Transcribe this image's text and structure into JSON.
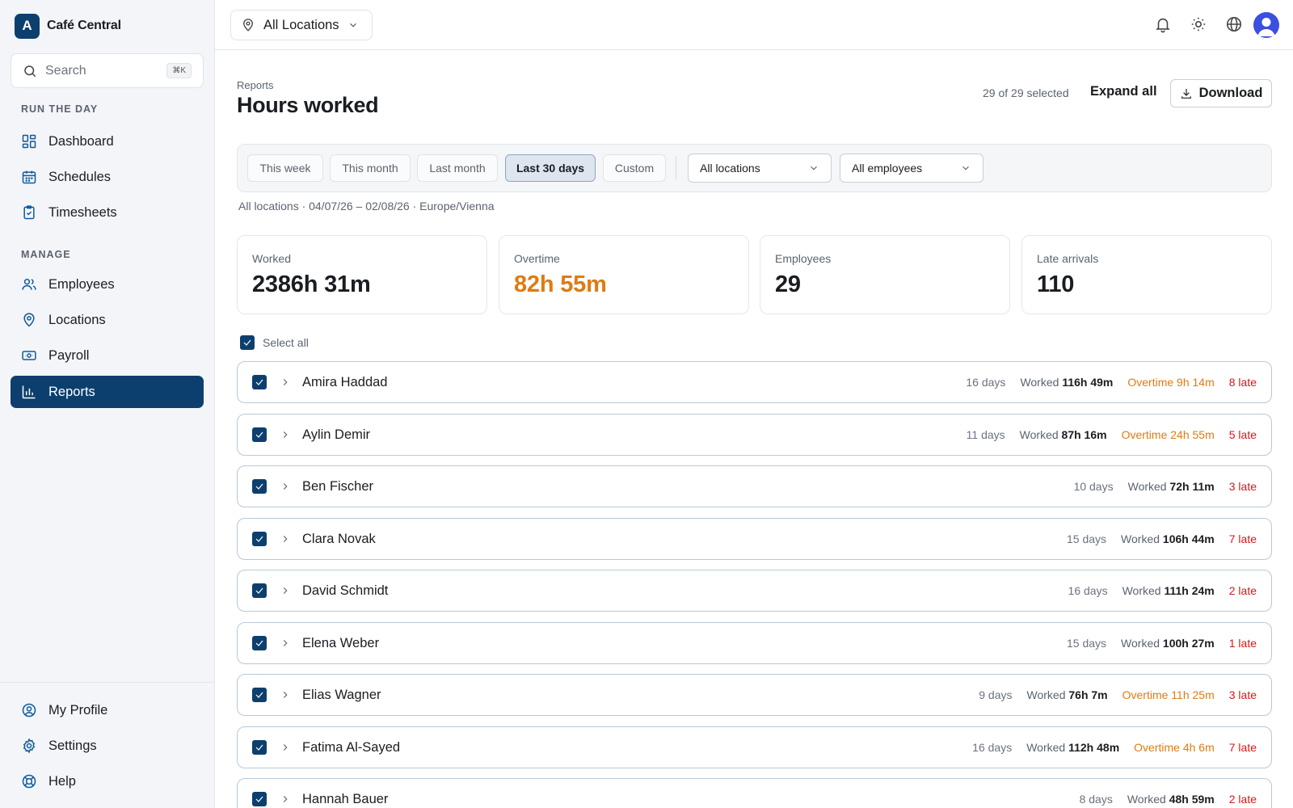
{
  "brand": {
    "logo_letter": "A",
    "name": "Café Central"
  },
  "search": {
    "placeholder": "Search",
    "shortcut": "⌘K"
  },
  "sidebar": {
    "sections": [
      {
        "label": "RUN THE DAY"
      },
      {
        "label": "MANAGE"
      }
    ],
    "items": [
      {
        "label": "Dashboard",
        "icon": "dashboard-icon"
      },
      {
        "label": "Schedules",
        "icon": "calendar-icon"
      },
      {
        "label": "Timesheets",
        "icon": "clipboard-icon"
      },
      {
        "label": "Employees",
        "icon": "users-icon"
      },
      {
        "label": "Locations",
        "icon": "map-pin-icon"
      },
      {
        "label": "Payroll",
        "icon": "banknote-icon"
      },
      {
        "label": "Reports",
        "icon": "bar-chart-icon",
        "active": true
      }
    ],
    "bottom_items": [
      {
        "label": "My Profile",
        "icon": "user-circle-icon"
      },
      {
        "label": "Settings",
        "icon": "gear-icon"
      },
      {
        "label": "Help",
        "icon": "lifebuoy-icon"
      }
    ]
  },
  "topbar": {
    "location": "All Locations"
  },
  "header": {
    "breadcrumb": "Reports",
    "title": "Hours worked",
    "selected_count": "29 of 29 selected",
    "expand_all": "Expand all",
    "download": "Download"
  },
  "filters": {
    "chips": [
      {
        "label": "This week"
      },
      {
        "label": "This month"
      },
      {
        "label": "Last month"
      },
      {
        "label": "Last 30 days",
        "active": true
      },
      {
        "label": "Custom"
      }
    ],
    "location_select": "All locations",
    "employee_select": "All employees",
    "meta": "All locations · 04/07/26 – 02/08/26 · Europe/Vienna"
  },
  "stats": [
    {
      "label": "Worked",
      "value": "2386h 31m"
    },
    {
      "label": "Overtime",
      "value": "82h 55m"
    },
    {
      "label": "Employees",
      "value": "29"
    },
    {
      "label": "Late arrivals",
      "value": "110"
    }
  ],
  "select_all": "Select all",
  "worked_prefix": "Worked",
  "employees": [
    {
      "name": "Amira Haddad",
      "days": "16 days",
      "worked": "116h 49m",
      "overtime": "Overtime 9h 14m",
      "late": "8 late"
    },
    {
      "name": "Aylin Demir",
      "days": "11 days",
      "worked": "87h 16m",
      "overtime": "Overtime 24h 55m",
      "late": "5 late"
    },
    {
      "name": "Ben Fischer",
      "days": "10 days",
      "worked": "72h 11m",
      "overtime": "",
      "late": "3 late"
    },
    {
      "name": "Clara Novak",
      "days": "15 days",
      "worked": "106h 44m",
      "overtime": "",
      "late": "7 late"
    },
    {
      "name": "David Schmidt",
      "days": "16 days",
      "worked": "111h 24m",
      "overtime": "",
      "late": "2 late"
    },
    {
      "name": "Elena Weber",
      "days": "15 days",
      "worked": "100h 27m",
      "overtime": "",
      "late": "1 late"
    },
    {
      "name": "Elias Wagner",
      "days": "9 days",
      "worked": "76h 7m",
      "overtime": "Overtime 11h 25m",
      "late": "3 late"
    },
    {
      "name": "Fatima Al-Sayed",
      "days": "16 days",
      "worked": "112h 48m",
      "overtime": "Overtime 4h 6m",
      "late": "7 late"
    },
    {
      "name": "Hannah Bauer",
      "days": "8 days",
      "worked": "48h 59m",
      "overtime": "",
      "late": "2 late"
    }
  ],
  "colors": {
    "primary": "#0d3f6e",
    "overtime": "#e07b12",
    "late": "#d11a1a"
  }
}
